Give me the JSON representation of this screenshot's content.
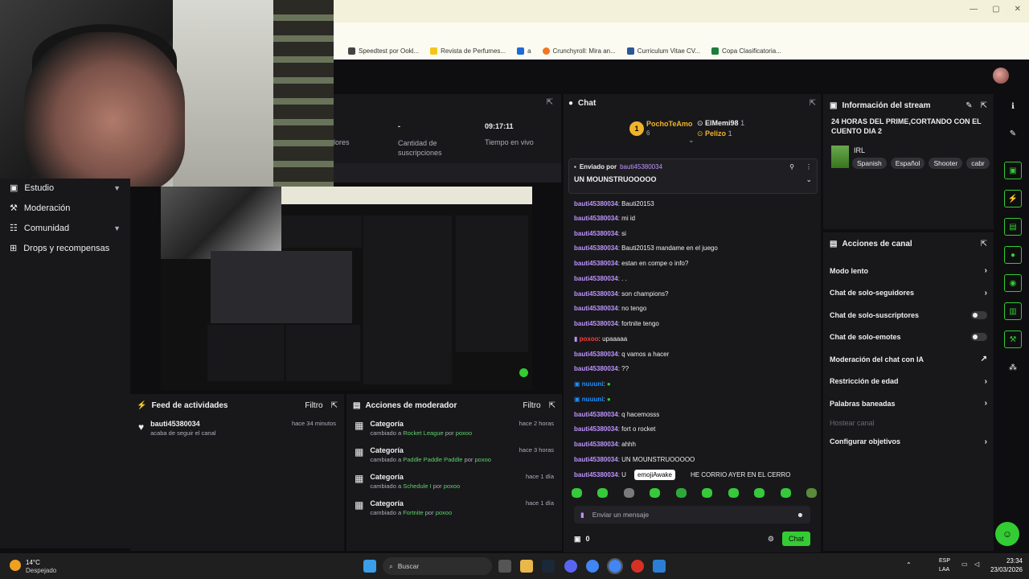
{
  "browser": {
    "bookmarks": [
      "Speedtest por Ookl...",
      "Revista de Perfumes...",
      "a",
      "Crunchyroll: Mira an...",
      "Curriculum Vitae CV...",
      "Copa Clasificatoria..."
    ],
    "bookmark_colors": [
      "#444",
      "#f5c518",
      "#1e6bd6",
      "#f47521",
      "#2b5797",
      "#1a7f3b"
    ]
  },
  "stats": {
    "partial_label": "lores",
    "subs_value": "-",
    "subs_label": "Cantidad de suscripciones",
    "time_value": "09:17:11",
    "time_label": "Tiempo en vivo"
  },
  "sidebar": {
    "items": [
      {
        "label": "Estudio",
        "icon": "video-icon",
        "chevron": true
      },
      {
        "label": "Moderación",
        "icon": "hammer-icon",
        "chevron": false
      },
      {
        "label": "Comunidad",
        "icon": "people-icon",
        "chevron": true
      },
      {
        "label": "Drops y recompensas",
        "icon": "gift-icon",
        "chevron": false
      }
    ]
  },
  "feed": {
    "title": "Feed de actividades",
    "filter": "Filtro",
    "items": [
      {
        "user": "bauti45380034",
        "sub": "acaba de seguir el canal",
        "time": "hace 34 minutos"
      }
    ]
  },
  "mod_actions": {
    "title": "Acciones de moderador",
    "filter": "Filtro",
    "items": [
      {
        "title": "Categoría",
        "prefix": "cambiado a",
        "value": "Rocket League",
        "by": "por",
        "user": "poxoo",
        "time": "hace 2 horas"
      },
      {
        "title": "Categoría",
        "prefix": "cambiado a",
        "value": "Paddle Paddle Paddle",
        "by": "por",
        "user": "poxoo",
        "time": "hace 3 horas"
      },
      {
        "title": "Categoría",
        "prefix": "cambiado a",
        "value": "Schedule I",
        "by": "por",
        "user": "poxoo",
        "time": "hace 1 día"
      },
      {
        "title": "Categoría",
        "prefix": "cambiado a",
        "value": "Fortnite",
        "by": "por",
        "user": "poxoo",
        "time": "hace 1 día"
      }
    ]
  },
  "chat": {
    "title": "Chat",
    "leaderboard": {
      "first_name": "PochoTeAmo",
      "first_count": "6",
      "first_rank": "1",
      "second_name": "ElMemi98",
      "second_count": "1",
      "third_name": "Pelizo",
      "third_count": "1"
    },
    "pinned": {
      "label": "Enviado por",
      "user": "bauti45380034",
      "text": "UN MOUNSTRUOOOOO"
    },
    "messages": [
      {
        "user": "bauti45380034",
        "text": "Bauti20153"
      },
      {
        "user": "bauti45380034",
        "text": "mi id"
      },
      {
        "user": "bauti45380034",
        "text": "si"
      },
      {
        "user": "bauti45380034",
        "text": "Bauti20153 mandame en el juego"
      },
      {
        "user": "bauti45380034",
        "text": "estan en compe o info?"
      },
      {
        "user": "bauti45380034",
        "text": ". ."
      },
      {
        "user": "bauti45380034",
        "text": "son champions?"
      },
      {
        "user": "bauti45380034",
        "text": "no tengo"
      },
      {
        "user": "bauti45380034",
        "text": "fortnite tengo"
      },
      {
        "user": "poxoo",
        "text": "upaaaaa"
      },
      {
        "user": "bauti45380034",
        "text": "q vamos a hacer"
      },
      {
        "user": "bauti45380034",
        "text": "??"
      },
      {
        "user": "nuuuni",
        "text": ""
      },
      {
        "user": "nuuuni",
        "text": ""
      },
      {
        "user": "bauti45380034",
        "text": "q hacemosss"
      },
      {
        "user": "bauti45380034",
        "text": "fort o rocket"
      },
      {
        "user": "bauti45380034",
        "text": "ahhh"
      },
      {
        "user": "bauti45380034",
        "text": "UN MOUNSTRUOOOOO"
      },
      {
        "user": "bauti45380034",
        "text": "U",
        "tail": "HE CORRIO AYER EN EL CERRO"
      }
    ],
    "tooltip": "emojiAwake",
    "input_placeholder": "Enviar un mensaje",
    "points": "0",
    "send_label": "Chat"
  },
  "stream_info": {
    "title": "Información del stream",
    "stream_title": "24 HORAS DEL PRIME,CORTANDO CON EL CUENTO DIA 2",
    "category": "IRL",
    "tags": [
      "Spanish",
      "Español",
      "Shooter",
      "cabr"
    ]
  },
  "channel_actions": {
    "title": "Acciones de canal",
    "rows": [
      {
        "label": "Modo lento",
        "control": "chevron"
      },
      {
        "label": "Chat de solo-seguidores",
        "control": "chevron"
      },
      {
        "label": "Chat de solo-suscriptores",
        "control": "toggle"
      },
      {
        "label": "Chat de solo-emotes",
        "control": "toggle"
      },
      {
        "label": "Moderación del chat con IA",
        "control": "external"
      },
      {
        "label": "Restricción de edad",
        "control": "chevron"
      },
      {
        "label": "Palabras baneadas",
        "control": "chevron"
      },
      {
        "label": "Hostear canal",
        "control": "none",
        "disabled": true
      },
      {
        "label": "Configurar objetivos",
        "control": "chevron"
      }
    ]
  },
  "taskbar": {
    "weather_temp": "14°C",
    "weather_desc": "Despejado",
    "search_placeholder": "Buscar",
    "lang_top": "ESP",
    "lang_bottom": "LAA",
    "time": "23:34",
    "date": "23/03/2026"
  },
  "colors": {
    "accent": "#33cc33",
    "username": "#bf94ff",
    "panel": "#18181b",
    "background": "#0e0e10"
  }
}
